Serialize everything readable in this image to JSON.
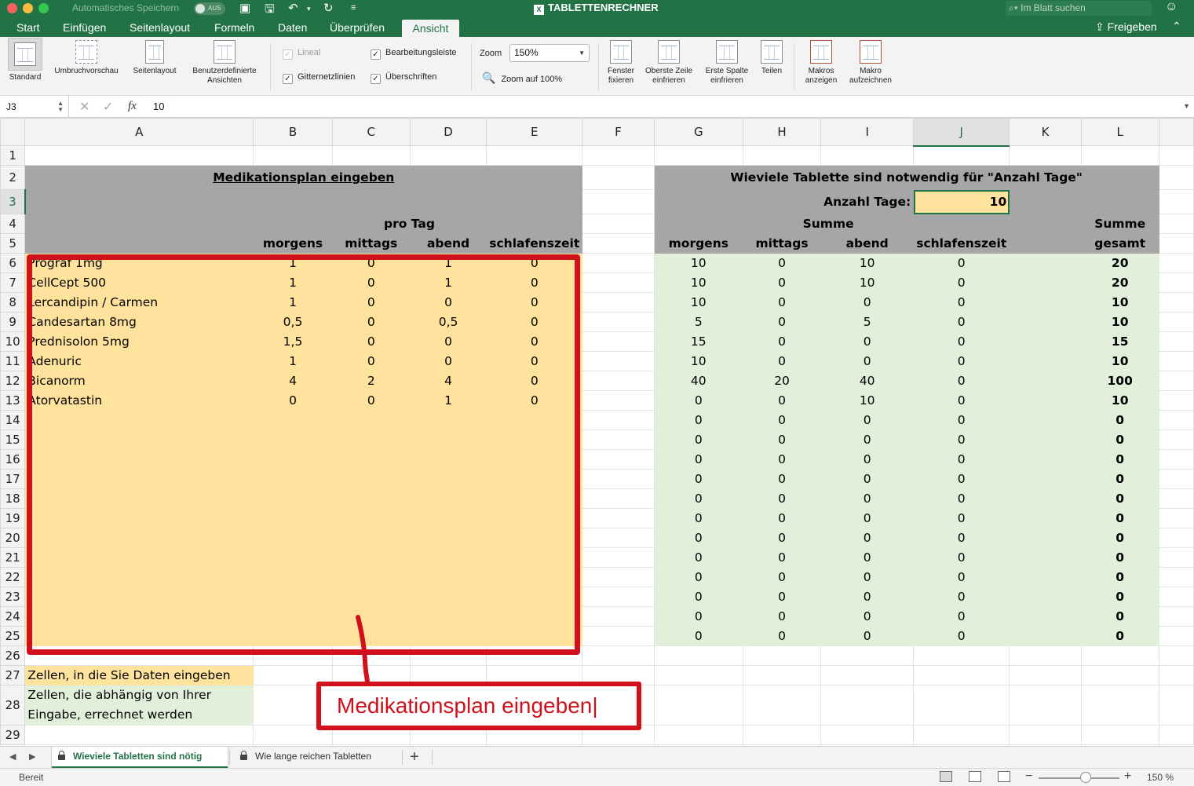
{
  "titlebar": {
    "autosave_label": "Automatisches Speichern",
    "autosave_state": "AUS",
    "document_title": "TABLETTENRECHNER",
    "search_placeholder": "Im Blatt suchen"
  },
  "ribbon_tabs": [
    "Start",
    "Einfügen",
    "Seitenlayout",
    "Formeln",
    "Daten",
    "Überprüfen",
    "Ansicht"
  ],
  "active_tab": "Ansicht",
  "share_label": "Freigeben",
  "ribbon": {
    "view_buttons": [
      {
        "label": "Standard"
      },
      {
        "label": "Umbruchvorschau"
      },
      {
        "label": "Seitenlayout"
      },
      {
        "label": "Benutzerdefinierte Ansichten"
      }
    ],
    "checkboxes": {
      "lineal": {
        "label": "Lineal",
        "checked": true,
        "enabled": false
      },
      "bearbeitungsleiste": {
        "label": "Bearbeitungsleiste",
        "checked": true,
        "enabled": true
      },
      "gitternetzlinien": {
        "label": "Gitternetzlinien",
        "checked": true,
        "enabled": true
      },
      "ueberschriften": {
        "label": "Überschriften",
        "checked": true,
        "enabled": true
      }
    },
    "zoom_label": "Zoom",
    "zoom_value": "150%",
    "zoom_100_label": "Zoom auf 100%",
    "window_buttons": [
      {
        "label": "Fenster fixieren"
      },
      {
        "label": "Oberste Zeile einfrieren"
      },
      {
        "label": "Erste Spalte einfrieren"
      },
      {
        "label": "Teilen"
      }
    ],
    "macro_buttons": [
      {
        "label": "Makros anzeigen"
      },
      {
        "label": "Makro aufzeichnen"
      }
    ]
  },
  "formula_bar": {
    "cell_ref": "J3",
    "fx": "fx",
    "value": "10"
  },
  "columns": [
    "A",
    "B",
    "C",
    "D",
    "E",
    "F",
    "G",
    "H",
    "I",
    "J",
    "K",
    "L",
    ""
  ],
  "selected_cell": {
    "col": "J",
    "row": 3
  },
  "left_block": {
    "title": "Medikationsplan eingeben",
    "pro_tag": "pro Tag",
    "headers": [
      "morgens",
      "mittags",
      "abend",
      "schlafenszeit"
    ],
    "rows": [
      {
        "name": "Prograf 1mg",
        "values": [
          "1",
          "0",
          "1",
          "0"
        ]
      },
      {
        "name": "CellCept 500",
        "values": [
          "1",
          "0",
          "1",
          "0"
        ]
      },
      {
        "name": "Lercandipin / Carmen",
        "values": [
          "1",
          "0",
          "0",
          "0"
        ]
      },
      {
        "name": "Candesartan 8mg",
        "values": [
          "0,5",
          "0",
          "0,5",
          "0"
        ]
      },
      {
        "name": "Prednisolon 5mg",
        "values": [
          "1,5",
          "0",
          "0",
          "0"
        ]
      },
      {
        "name": "Adenuric",
        "values": [
          "1",
          "0",
          "0",
          "0"
        ]
      },
      {
        "name": "Bicanorm",
        "values": [
          "4",
          "2",
          "4",
          "0"
        ]
      },
      {
        "name": "Atorvatastin",
        "values": [
          "0",
          "0",
          "1",
          "0"
        ]
      }
    ]
  },
  "right_block": {
    "title": "Wieviele Tablette sind notwendig für \"Anzahl Tage\"",
    "anzahl_tage_label": "Anzahl Tage:",
    "anzahl_tage_value": "10",
    "summe_label": "Summe",
    "summe_gesamt_label_1": "Summe",
    "summe_gesamt_label_2": "gesamt",
    "headers": [
      "morgens",
      "mittags",
      "abend",
      "schlafenszeit"
    ],
    "rows": [
      {
        "values": [
          "10",
          "0",
          "10",
          "0"
        ],
        "total": "20"
      },
      {
        "values": [
          "10",
          "0",
          "10",
          "0"
        ],
        "total": "20"
      },
      {
        "values": [
          "10",
          "0",
          "0",
          "0"
        ],
        "total": "10"
      },
      {
        "values": [
          "5",
          "0",
          "5",
          "0"
        ],
        "total": "10"
      },
      {
        "values": [
          "15",
          "0",
          "0",
          "0"
        ],
        "total": "15"
      },
      {
        "values": [
          "10",
          "0",
          "0",
          "0"
        ],
        "total": "10"
      },
      {
        "values": [
          "40",
          "20",
          "40",
          "0"
        ],
        "total": "100"
      },
      {
        "values": [
          "0",
          "0",
          "10",
          "0"
        ],
        "total": "10"
      },
      {
        "values": [
          "0",
          "0",
          "0",
          "0"
        ],
        "total": "0"
      },
      {
        "values": [
          "0",
          "0",
          "0",
          "0"
        ],
        "total": "0"
      },
      {
        "values": [
          "0",
          "0",
          "0",
          "0"
        ],
        "total": "0"
      },
      {
        "values": [
          "0",
          "0",
          "0",
          "0"
        ],
        "total": "0"
      },
      {
        "values": [
          "0",
          "0",
          "0",
          "0"
        ],
        "total": "0"
      },
      {
        "values": [
          "0",
          "0",
          "0",
          "0"
        ],
        "total": "0"
      },
      {
        "values": [
          "0",
          "0",
          "0",
          "0"
        ],
        "total": "0"
      },
      {
        "values": [
          "0",
          "0",
          "0",
          "0"
        ],
        "total": "0"
      },
      {
        "values": [
          "0",
          "0",
          "0",
          "0"
        ],
        "total": "0"
      },
      {
        "values": [
          "0",
          "0",
          "0",
          "0"
        ],
        "total": "0"
      },
      {
        "values": [
          "0",
          "0",
          "0",
          "0"
        ],
        "total": "0"
      },
      {
        "values": [
          "0",
          "0",
          "0",
          "0"
        ],
        "total": "0"
      }
    ]
  },
  "legend": {
    "input_cells": "Zellen, in die Sie Daten eingeben",
    "calc_cells_1": "Zellen, die abhängig von Ihrer",
    "calc_cells_2": "Eingabe, errechnet werden"
  },
  "annotation": {
    "label": "Medikationsplan eingeben|",
    "color": "#d0111b"
  },
  "sheet_tabs": [
    {
      "label": "Wieviele Tabletten sind nötig",
      "active": true
    },
    {
      "label": "Wie lange reichen Tabletten",
      "active": false
    }
  ],
  "status": {
    "text": "Bereit",
    "zoom": "150 %"
  },
  "colors": {
    "excel_green": "#217346",
    "input_yellow": "#ffe29b",
    "calc_green": "#e2efda",
    "header_gray": "#a6a6a6"
  }
}
